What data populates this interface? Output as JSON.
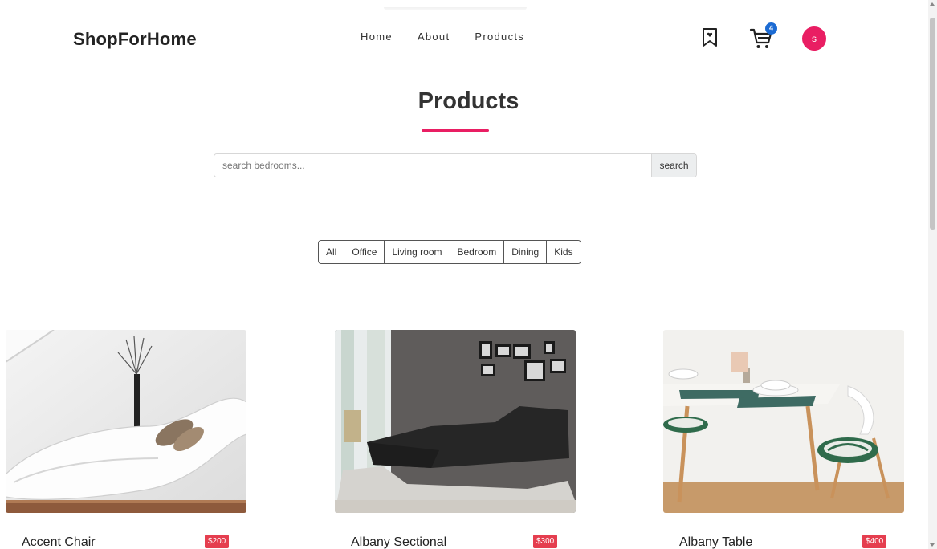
{
  "brand": "ShopForHome",
  "nav": [
    "Home",
    "About",
    "Products"
  ],
  "header_icons": {
    "bookmark_icon": "bookmark-icon",
    "cart_icon": "cart-icon",
    "cart_count": "4",
    "avatar_initial": "s"
  },
  "colors": {
    "accent": "#e91e63",
    "badge": "#1c6bd3",
    "price_tag": "#e53e4f"
  },
  "page_title": "Products",
  "search": {
    "placeholder": "search bedrooms...",
    "value": "",
    "button_label": "search"
  },
  "filters": [
    "All",
    "Office",
    "Living room",
    "Bedroom",
    "Dining",
    "Kids"
  ],
  "products": [
    {
      "name": "Accent Chair",
      "price": "$200"
    },
    {
      "name": "Albany Sectional",
      "price": "$300"
    },
    {
      "name": "Albany Table",
      "price": "$400"
    }
  ]
}
